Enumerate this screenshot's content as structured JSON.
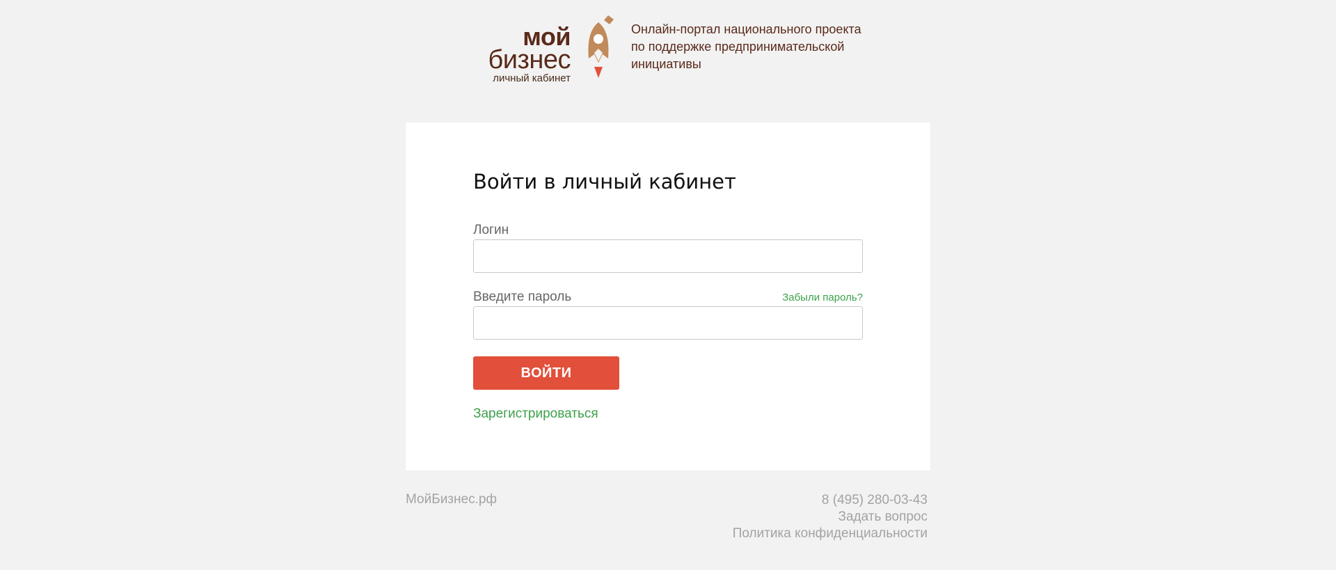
{
  "header": {
    "logo_line1": "мой",
    "logo_line2": "бизнес",
    "logo_sub": "личный кабинет",
    "tagline": [
      "Онлайн-портал национального проекта",
      "по поддержке предпринимательской",
      "инициативы"
    ]
  },
  "login_card": {
    "title": "Войти в личный кабинет",
    "login_label": "Логин",
    "login_value": "",
    "password_label": "Введите пароль",
    "password_value": "",
    "forgot_link": "Забыли пароль?",
    "submit_label": "ВОЙТИ",
    "register_link": "Зарегистрироваться"
  },
  "footer": {
    "site": "МойБизнес.рф",
    "phone": "8 (495) 280-03-43",
    "ask": "Задать вопрос",
    "privacy": "Политика конфиденциальности"
  },
  "colors": {
    "background": "#f2f2f2",
    "brand_brown": "#5a2a1a",
    "rocket_tan": "#c08a5a",
    "accent_red": "#e24f3a",
    "link_green": "#3da14a",
    "footer_gray": "#a3a3a3"
  },
  "icons": {
    "logo": "rocket-icon"
  }
}
